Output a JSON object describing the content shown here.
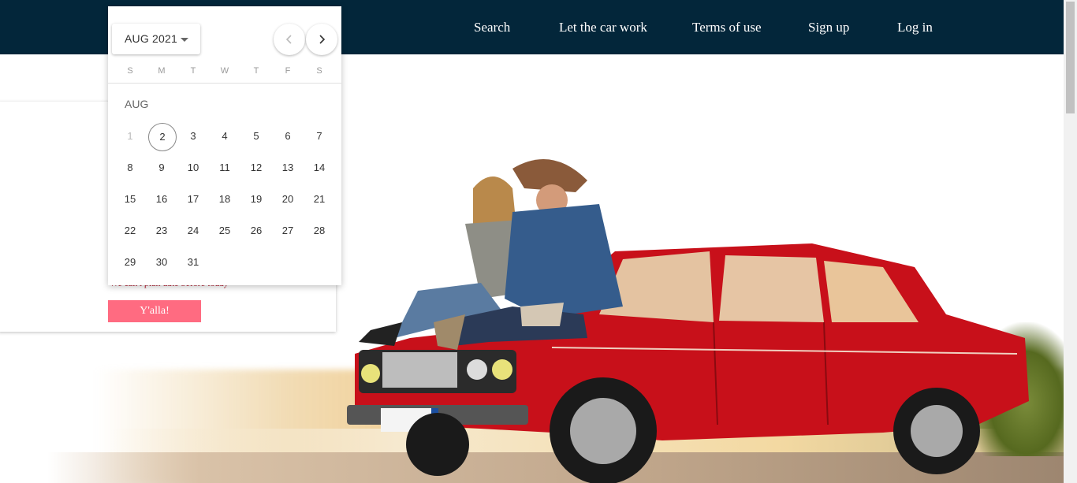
{
  "nav": {
    "items": [
      "Search",
      "Let the car work",
      "Terms of use",
      "Sign up",
      "Log in"
    ]
  },
  "card": {
    "text": "We can't plan date before today",
    "button": "Y'alla!"
  },
  "datepicker": {
    "month_select": "AUG 2021",
    "weekdays": [
      "S",
      "M",
      "T",
      "W",
      "T",
      "F",
      "S"
    ],
    "month_label": "AUG",
    "weeks": [
      [
        "1",
        "2",
        "3",
        "4",
        "5",
        "6",
        "7"
      ],
      [
        "8",
        "9",
        "10",
        "11",
        "12",
        "13",
        "14"
      ],
      [
        "15",
        "16",
        "17",
        "18",
        "19",
        "20",
        "21"
      ],
      [
        "22",
        "23",
        "24",
        "25",
        "26",
        "27",
        "28"
      ],
      [
        "29",
        "30",
        "31"
      ]
    ],
    "disabled_days": [
      "1"
    ],
    "today": "2"
  },
  "colors": {
    "topbar": "#03263a",
    "cta": "#ff6b81",
    "car": "#c8101a"
  },
  "icons": [
    "chevron-left-icon",
    "chevron-right-icon",
    "caret-down-icon"
  ]
}
